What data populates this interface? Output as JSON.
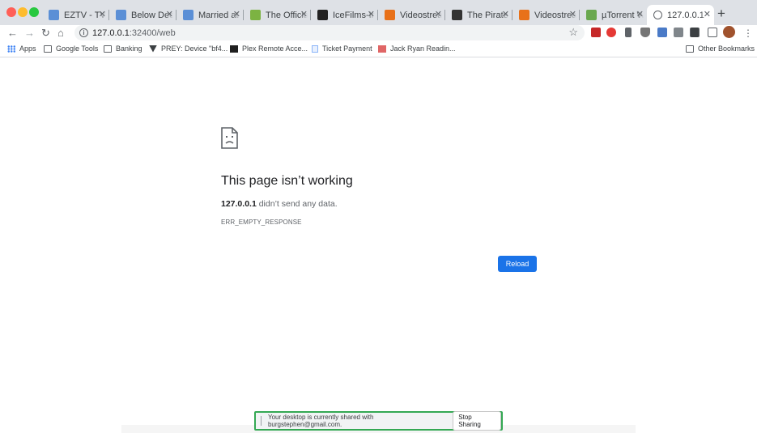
{
  "colors": {
    "tabstrip_bg": "#dee1e6",
    "reload_button": "#1a73e8",
    "share_border": "#34a853",
    "traffic_close": "#ff5f57",
    "traffic_min": "#febc2e",
    "traffic_max": "#28c840"
  },
  "tabs": [
    {
      "title": "EZTV - TV",
      "icon": "eztv-icon",
      "color": "#5b8fd6"
    },
    {
      "title": "Below Deck",
      "icon": "eztv-icon",
      "color": "#5b8fd6"
    },
    {
      "title": "Married at",
      "icon": "eztv-icon",
      "color": "#5b8fd6"
    },
    {
      "title": "The Official",
      "icon": "eztv-icon",
      "color": "#7cb342"
    },
    {
      "title": "IceFilms-In",
      "icon": "icefilms-icon",
      "color": "#222222"
    },
    {
      "title": "Videostrea",
      "icon": "play-icon",
      "color": "#e8711a"
    },
    {
      "title": "The Pirate",
      "icon": "pirate-ship-icon",
      "color": "#333333"
    },
    {
      "title": "Videostrea",
      "icon": "play-icon",
      "color": "#e8711a"
    },
    {
      "title": "µTorrent W",
      "icon": "utorrent-icon",
      "color": "#6aa84f"
    },
    {
      "title": "127.0.0.1",
      "icon": "globe-icon",
      "color": "#5f6368",
      "active": true
    }
  ],
  "omnibox": {
    "host": "127.0.0.1",
    "path": ":32400/web"
  },
  "bookmarks": {
    "apps": "Apps",
    "items": [
      {
        "label": "Google Tools",
        "icon": "folder-icon"
      },
      {
        "label": "Banking",
        "icon": "folder-icon"
      },
      {
        "label": "PREY: Device \"bf4...",
        "icon": "prey-icon"
      },
      {
        "label": "Plex Remote Acce...",
        "icon": "plex-icon"
      },
      {
        "label": "Ticket Payment",
        "icon": "document-icon"
      },
      {
        "label": "Jack Ryan Readin...",
        "icon": "bookmark-icon"
      }
    ],
    "other": "Other Bookmarks"
  },
  "error": {
    "title": "This page isn’t working",
    "host": "127.0.0.1",
    "message": " didn’t send any data.",
    "code": "ERR_EMPTY_RESPONSE",
    "reload": "Reload"
  },
  "share_bar": {
    "message": "Your desktop is currently shared with burgstephen@gmail.com.",
    "stop": "Stop Sharing"
  }
}
